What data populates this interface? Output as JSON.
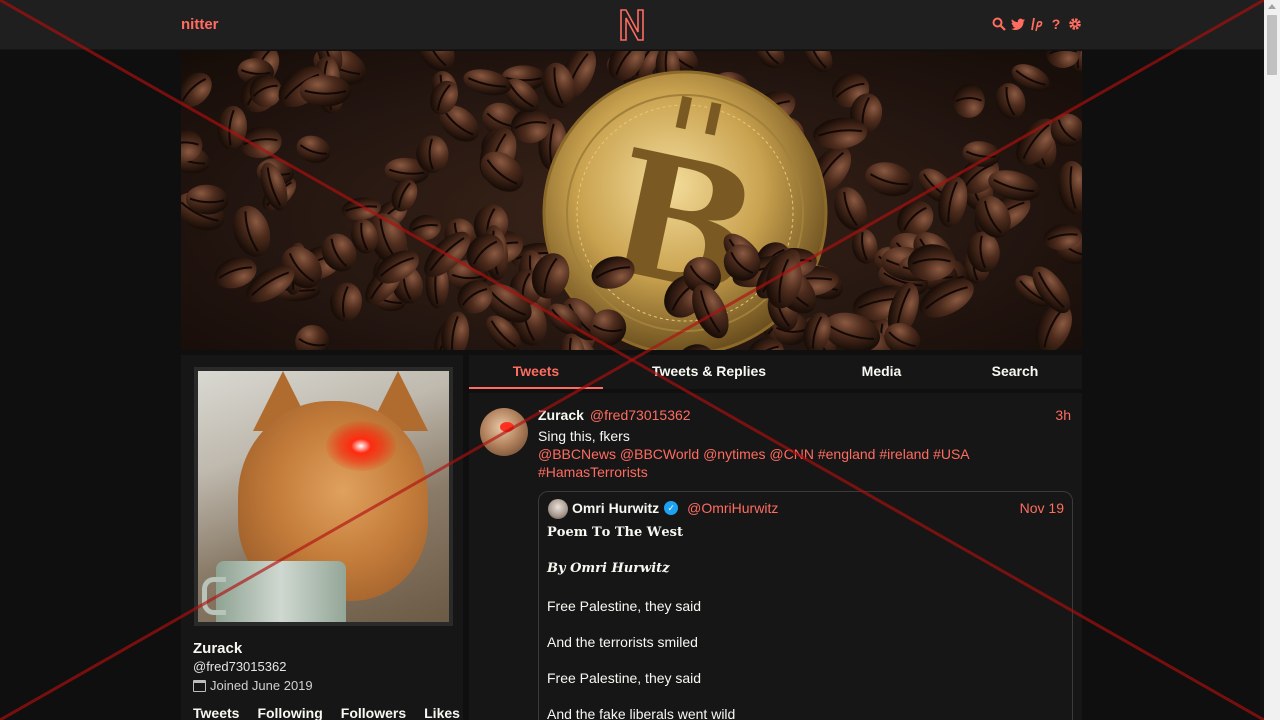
{
  "navbar": {
    "brand": "nitter",
    "icons": [
      "search-icon",
      "twitter-bird-icon",
      "lp-icon",
      "help-icon",
      "gear-icon"
    ],
    "icon_glyphs": [
      "⌕",
      "🐦",
      "ℓp",
      "?",
      "⚙"
    ]
  },
  "profile": {
    "fullname": "Zurack",
    "username": "@fred73015362",
    "joined": "Joined June 2019",
    "stats": [
      "Tweets",
      "Following",
      "Followers",
      "Likes"
    ]
  },
  "tabs": [
    {
      "label": "Tweets",
      "active": true
    },
    {
      "label": "Tweets & Replies",
      "active": false
    },
    {
      "label": "Media",
      "active": false
    },
    {
      "label": "Search",
      "active": false
    }
  ],
  "tweet": {
    "fullname": "Zurack",
    "handle": "@fred73015362",
    "date": "3h",
    "text": "Sing this, fkers",
    "links": "@BBCNews @BBCWorld @nytimes @CNN #england #ireland #USA #HamasTerrorists",
    "quote": {
      "fullname": "Omri Hurwitz",
      "handle": "@OmriHurwitz",
      "date": "Nov 19",
      "title": "𝐏𝐨𝐞𝐦 𝐓𝐨 𝐓𝐡𝐞 𝐖𝐞𝐬𝐭",
      "byline": "𝑩𝒚 𝑶𝒎𝒓𝒊 𝑯𝒖𝒓𝒘𝒊𝒕𝒛",
      "lines": [
        "Free Palestine, they said",
        "And the terrorists smiled",
        "Free Palestine, they said",
        "And the fake liberals went wild"
      ]
    }
  },
  "colors": {
    "accent": "#ff6c60",
    "background": "#0f0f0f",
    "panel": "#161616",
    "overlay_x": "#b01010"
  }
}
